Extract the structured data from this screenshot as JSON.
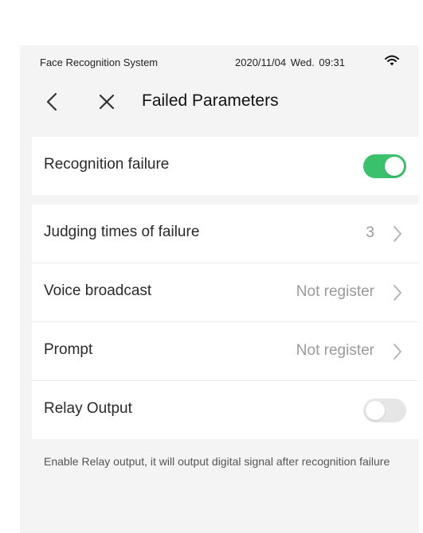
{
  "status_bar": {
    "app_name": "Face Recognition System",
    "datetime": "2020/11/04 Wed. 09:31",
    "wifi_icon": "wifi-icon"
  },
  "nav": {
    "title": "Failed Parameters",
    "back_icon": "chevron-left-icon",
    "close_icon": "close-icon"
  },
  "recognition_failure": {
    "label": "Recognition failure",
    "enabled": true
  },
  "settings": {
    "judging_times": {
      "label": "Judging times of failure",
      "value": "3"
    },
    "voice_broadcast": {
      "label": "Voice broadcast",
      "value": "Not register"
    },
    "prompt": {
      "label": "Prompt",
      "value": "Not register"
    },
    "relay_output": {
      "label": "Relay Output",
      "enabled": false
    }
  },
  "note": "Enable Relay output, it will output digital signal after recognition failure",
  "colors": {
    "toggle_on": "#3ac16c",
    "toggle_off": "#e6e6e6",
    "background": "#f4f4f4",
    "card": "#ffffff"
  }
}
